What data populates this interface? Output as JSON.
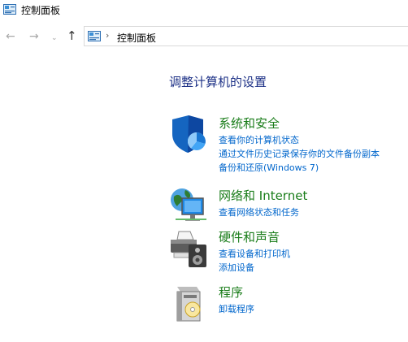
{
  "window": {
    "title": "控制面板"
  },
  "nav": {
    "back_icon": "←",
    "forward_icon": "→",
    "dropdown_icon": "⌄",
    "up_icon": "↑"
  },
  "address_bar": {
    "separator": "›",
    "path": "控制面板"
  },
  "main": {
    "heading": "调整计算机的设置",
    "categories": [
      {
        "title": "系统和安全",
        "icon": "shield-icon",
        "links": [
          "查看你的计算机状态",
          "通过文件历史记录保存你的文件备份副本",
          "备份和还原(Windows 7)"
        ]
      },
      {
        "title": "网络和 Internet",
        "icon": "network-globe-icon",
        "links": [
          "查看网络状态和任务"
        ]
      },
      {
        "title": "硬件和声音",
        "icon": "printer-speaker-icon",
        "links": [
          "查看设备和打印机",
          "添加设备"
        ]
      },
      {
        "title": "程序",
        "icon": "programs-disc-icon",
        "links": [
          "卸载程序"
        ]
      }
    ]
  }
}
